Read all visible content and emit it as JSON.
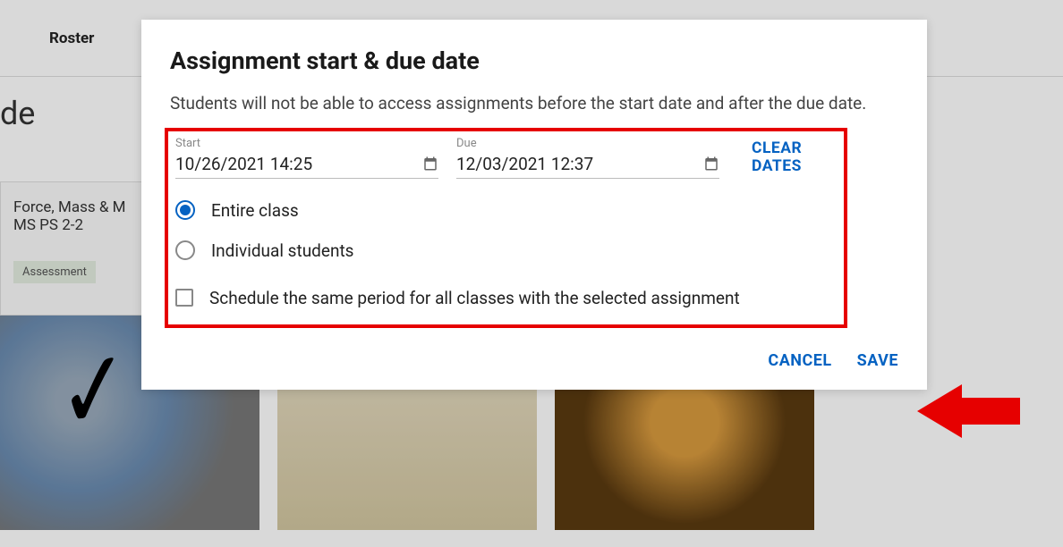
{
  "header": {
    "tab": "Roster"
  },
  "bg": {
    "title_fragment": "de",
    "card_title": "Force, Mass & M\nMS PS 2-2",
    "badge": "Assessment"
  },
  "dialog": {
    "title": "Assignment start & due date",
    "description": "Students will not be able to access assignments before the start date and after the due date.",
    "start_label": "Start",
    "start_value": "10/26/2021 14:25",
    "due_label": "Due",
    "due_value": "12/03/2021 12:37",
    "clear_dates": "CLEAR DATES",
    "option_entire": "Entire class",
    "option_individual": "Individual students",
    "option_schedule": "Schedule the same period for all classes with the selected assignment",
    "selected_option": "entire",
    "cancel": "CANCEL",
    "save": "SAVE"
  }
}
